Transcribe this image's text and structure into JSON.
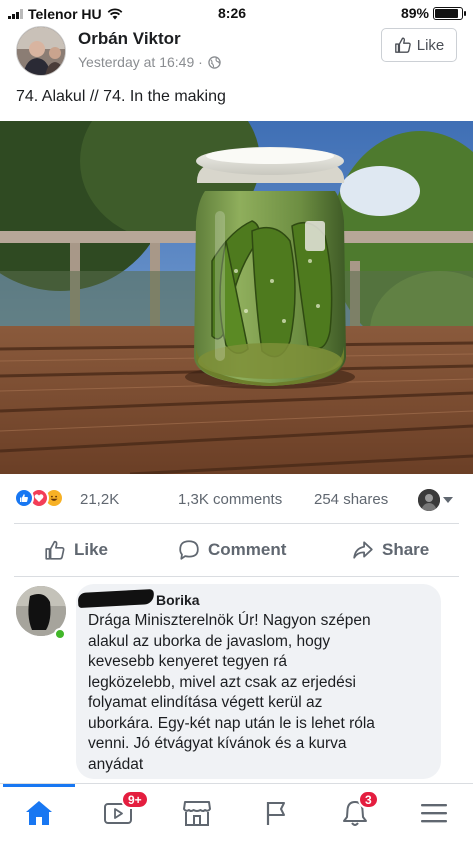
{
  "status_bar": {
    "carrier": "Telenor HU",
    "time": "8:26",
    "battery_percent": "89%",
    "battery_level": 0.89,
    "icons": [
      "signal-icon",
      "wifi-icon",
      "battery-icon"
    ]
  },
  "post": {
    "author": "Orbán Viktor",
    "timestamp": "Yesterday at 16:49 ·",
    "privacy_icon": "globe-icon",
    "like_page_label": "Like",
    "text": "74. Alakul // 74. In the making"
  },
  "stats": {
    "reactions": [
      "like",
      "love",
      "haha"
    ],
    "reaction_count": "21,2K",
    "comments": "1,3K comments",
    "shares": "254 shares"
  },
  "actions": {
    "like": "Like",
    "comment": "Comment",
    "share": "Share"
  },
  "comment": {
    "author_visible": "Borika",
    "text": "Drága Miniszterelnök Úr! Nagyon szépen\nalakul az uborka de javaslom, hogy\nkevesebb kenyeret tegyen rá\nlegközelebb, mivel azt csak az erjedési\nfolyamat elindítása végett kerül az\nuborkára. Egy-két nap után le is lehet róla\nvenni. Jó étvágyat kívánok és a kurva\nanyádat"
  },
  "tab_bar": {
    "tabs": [
      "home-icon",
      "watch-icon",
      "marketplace-icon",
      "pages-flag-icon",
      "notifications-bell-icon",
      "menu-icon"
    ],
    "watch_badge": "9+",
    "notifications_badge": "3"
  },
  "colors": {
    "facebook_blue": "#1877f2",
    "like_blue": "#1877f2",
    "love_red": "#f33e58",
    "haha_yellow": "#f7b125",
    "badge_red": "#e41e3f",
    "secondary_text": "#606770"
  }
}
